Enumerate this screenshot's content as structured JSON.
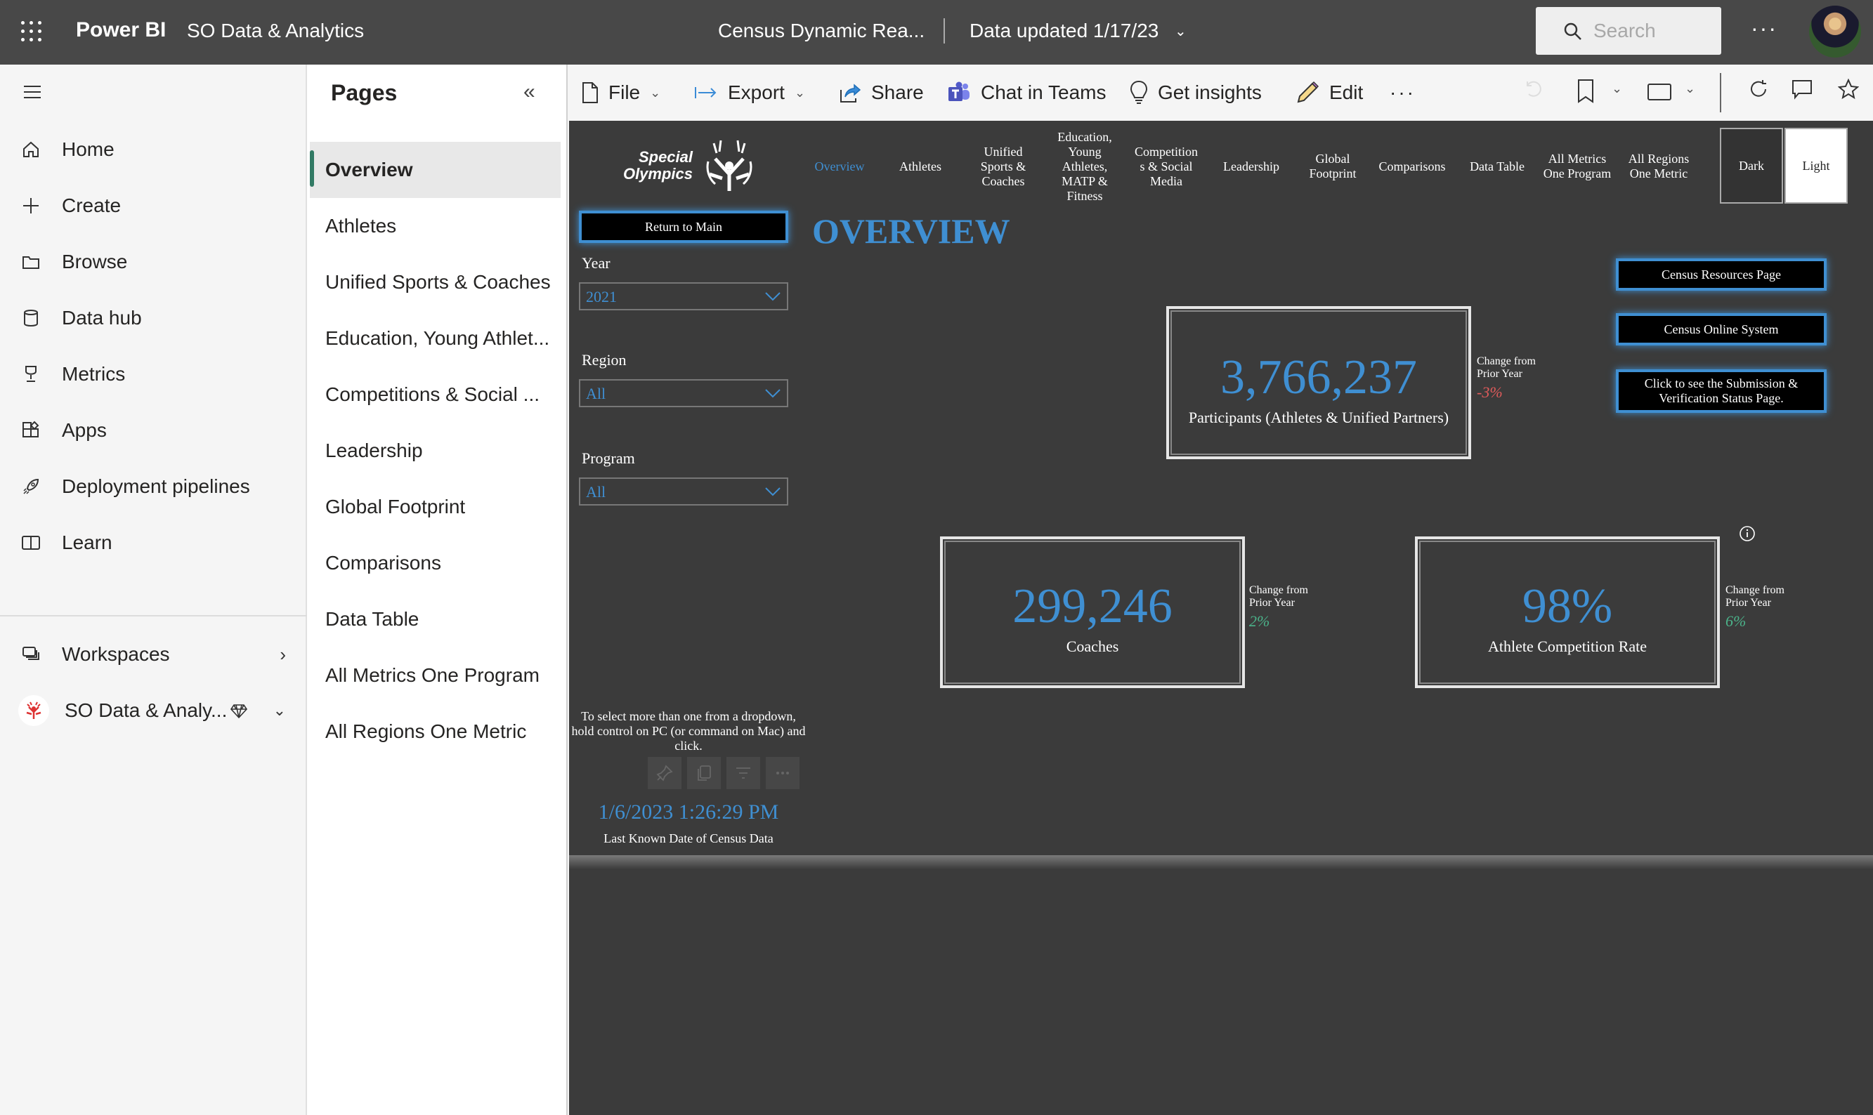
{
  "topbar": {
    "app_name": "Power BI",
    "workspace": "SO Data & Analytics",
    "report_title": "Census Dynamic Rea...",
    "data_updated": "Data updated 1/17/23",
    "search_placeholder": "Search",
    "more": "···"
  },
  "leftnav": {
    "items": [
      {
        "label": "Home",
        "icon": "home-icon"
      },
      {
        "label": "Create",
        "icon": "plus-icon"
      },
      {
        "label": "Browse",
        "icon": "folder-icon"
      },
      {
        "label": "Data hub",
        "icon": "database-icon"
      },
      {
        "label": "Metrics",
        "icon": "trophy-icon"
      },
      {
        "label": "Apps",
        "icon": "apps-icon"
      },
      {
        "label": "Deployment pipelines",
        "icon": "rocket-icon"
      },
      {
        "label": "Learn",
        "icon": "book-icon"
      }
    ],
    "workspaces": "Workspaces",
    "current_workspace": "SO Data & Analy..."
  },
  "pages": {
    "title": "Pages",
    "items": [
      "Overview",
      "Athletes",
      "Unified Sports & Coaches",
      "Education, Young Athlet...",
      "Competitions & Social ...",
      "Leadership",
      "Global Footprint",
      "Comparisons",
      "Data Table",
      "All Metrics One Program",
      "All Regions One Metric"
    ],
    "active_index": 0
  },
  "toolbar": {
    "file": "File",
    "export": "Export",
    "share": "Share",
    "chat_in_teams": "Chat in Teams",
    "get_insights": "Get insights",
    "edit": "Edit",
    "more": "···"
  },
  "report": {
    "logo_text_1": "Special",
    "logo_text_2": "Olympics",
    "nav": [
      "Overview",
      "Athletes",
      "Unified Sports & Coaches",
      "Education, Young Athletes, MATP & Fitness",
      "Competition s & Social Media",
      "Leadership",
      "Global Footprint",
      "Comparisons",
      "Data Table",
      "All Metrics One Program",
      "All Regions One Metric"
    ],
    "theme_dark": "Dark",
    "theme_light": "Light",
    "return_to_main": "Return to Main",
    "page_heading": "OVERVIEW",
    "filters": {
      "year_label": "Year",
      "year_value": "2021",
      "region_label": "Region",
      "region_value": "All",
      "program_label": "Program",
      "program_value": "All"
    },
    "hint": "To select more than one from a dropdown, hold control on PC (or command on Mac) and click.",
    "last_known_date": "1/6/2023 1:26:29 PM",
    "last_known_date_label": "Last Known Date of Census Data",
    "links": {
      "census_resources": "Census Resources Page",
      "census_online": "Census Online System",
      "submission_status": "Click to see the Submission & Verification Status Page."
    },
    "kpis": {
      "participants": {
        "value": "3,766,237",
        "label": "Participants (Athletes & Unified Partners)",
        "change_label": "Change from Prior Year",
        "change": "-3%"
      },
      "coaches": {
        "value": "299,246",
        "label": "Coaches",
        "change_label": "Change from Prior Year",
        "change": "2%"
      },
      "competition_rate": {
        "value": "98%",
        "label": "Athlete Competition Rate",
        "change_label": "Change from Prior Year",
        "change": "6%"
      }
    },
    "colors": {
      "accent": "#3f8fd2",
      "negative": "#e05b5b",
      "positive": "#4bb38a",
      "canvas": "#3b3b3b"
    }
  }
}
